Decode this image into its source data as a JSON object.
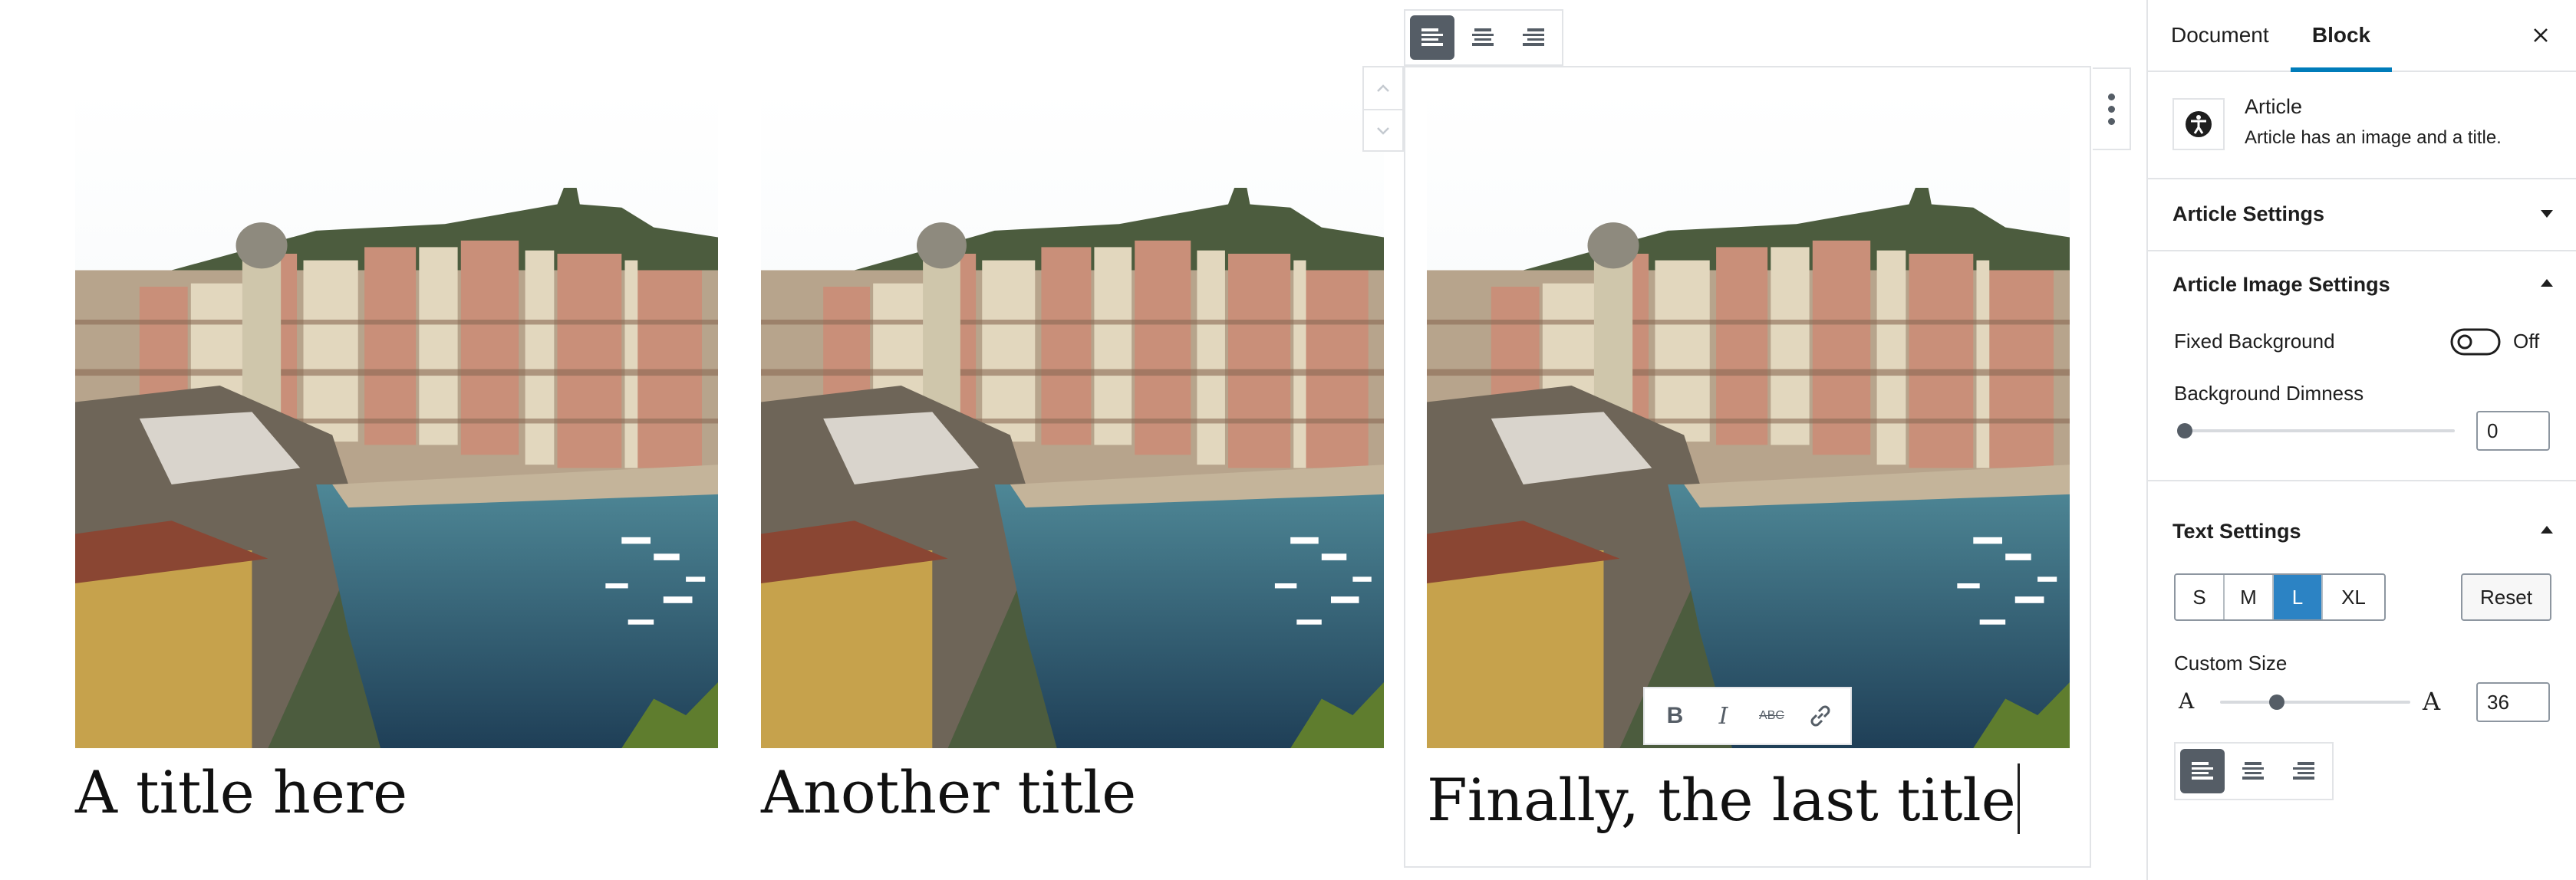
{
  "articles": [
    {
      "title": "A title here"
    },
    {
      "title": "Another title"
    },
    {
      "title": "Finally, the last title"
    }
  ],
  "block_toolbar": {
    "align_icons": [
      "align-left-icon",
      "align-center-icon",
      "align-right-icon"
    ],
    "active": "align-left"
  },
  "format_toolbar": {
    "bold": "B",
    "italic": "I",
    "strikethrough": "ABC"
  },
  "sidebar": {
    "tabs": {
      "document": "Document",
      "block": "Block"
    },
    "block_card": {
      "name": "Article",
      "description": "Article has an image and a title."
    },
    "panels": {
      "article_settings": "Article Settings",
      "image_settings": {
        "title": "Article Image Settings",
        "fixed_background_label": "Fixed Background",
        "fixed_background_state": "Off",
        "dimness_label": "Background Dimness",
        "dimness_value": "0"
      },
      "text_settings": {
        "title": "Text Settings",
        "sizes": [
          "S",
          "M",
          "L",
          "XL"
        ],
        "selected_size": "L",
        "reset_label": "Reset",
        "custom_size_label": "Custom Size",
        "small_a": "A",
        "large_a": "A",
        "custom_size_value": "36"
      }
    }
  },
  "colors": {
    "accent": "#007cba",
    "active_size": "#2c83c4",
    "toolbar_active": "#555d66"
  }
}
